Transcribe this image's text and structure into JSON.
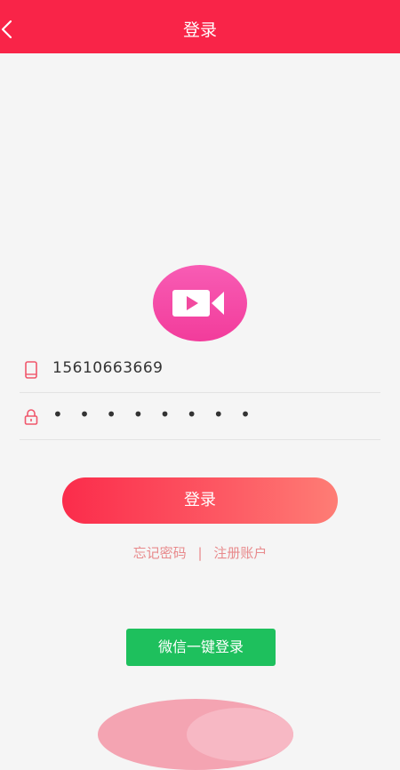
{
  "header": {
    "title": "登录",
    "back_icon": "chevron-left-icon",
    "background_color": "#f92448"
  },
  "logo": {
    "icon": "video-camera-icon"
  },
  "form": {
    "phone": {
      "icon": "phone-icon",
      "value": "15610663669"
    },
    "password": {
      "icon": "lock-icon",
      "value": "• • • • • • • •"
    }
  },
  "actions": {
    "login_label": "登录",
    "forgot_password": "忘记密码",
    "separator": "|",
    "register": "注册账户",
    "wechat_login": "微信一键登录"
  },
  "colors": {
    "accent": "#f92448",
    "wechat_green": "#1ec05d",
    "link": "#e88a8c"
  }
}
